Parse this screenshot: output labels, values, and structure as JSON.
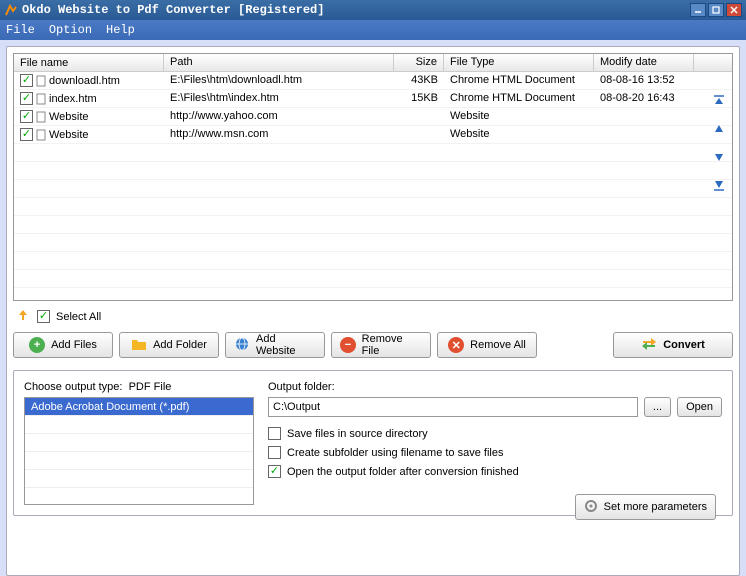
{
  "title": "Okdo Website to Pdf Converter [Registered]",
  "menu": {
    "file": "File",
    "option": "Option",
    "help": "Help"
  },
  "columns": {
    "name": "File name",
    "path": "Path",
    "size": "Size",
    "type": "File Type",
    "date": "Modify date"
  },
  "rows": [
    {
      "checked": true,
      "name": "downloadl.htm",
      "path": "E:\\Files\\htm\\downloadl.htm",
      "size": "43KB",
      "type": "Chrome HTML Document",
      "date": "08-08-16 13:52"
    },
    {
      "checked": true,
      "name": "index.htm",
      "path": "E:\\Files\\htm\\index.htm",
      "size": "15KB",
      "type": "Chrome HTML Document",
      "date": "08-08-20 16:43"
    },
    {
      "checked": true,
      "name": "Website",
      "path": "http://www.yahoo.com",
      "size": "",
      "type": "Website",
      "date": ""
    },
    {
      "checked": true,
      "name": "Website",
      "path": "http://www.msn.com",
      "size": "",
      "type": "Website",
      "date": ""
    }
  ],
  "select_all": "Select All",
  "buttons": {
    "add_files": "Add Files",
    "add_folder": "Add Folder",
    "add_website": "Add Website",
    "remove_file": "Remove File",
    "remove_all": "Remove All",
    "convert": "Convert"
  },
  "output": {
    "choose_type_label": "Choose output type:",
    "type_value": "PDF File",
    "type_options": [
      "Adobe Acrobat Document (*.pdf)"
    ],
    "folder_label": "Output folder:",
    "folder_value": "C:\\Output",
    "browse": "...",
    "open": "Open",
    "save_source": "Save files in source directory",
    "create_sub": "Create subfolder using filename to save files",
    "open_after": "Open the output folder after conversion finished",
    "set_more": "Set more parameters"
  }
}
